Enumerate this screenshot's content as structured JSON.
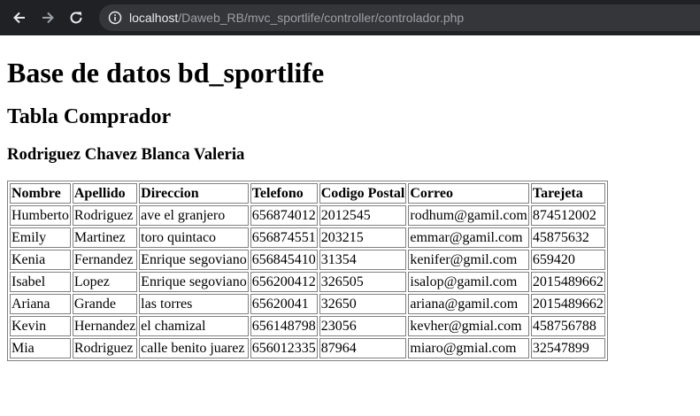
{
  "browser": {
    "url_host": "localhost",
    "url_path": "/Daweb_RB/mvc_sportlife/controller/controlador.php"
  },
  "page": {
    "title": "Base de datos bd_sportlife",
    "subtitle": "Tabla Comprador",
    "author": "Rodriguez Chavez Blanca Valeria"
  },
  "table": {
    "headers": [
      "Nombre",
      "Apellido",
      "Direccion",
      "Telefono",
      "Codigo Postal",
      "Correo",
      "Tarejeta"
    ],
    "rows": [
      [
        "Humberto",
        "Rodriguez",
        "ave el granjero",
        "656874012",
        "2012545",
        "rodhum@gamil.com",
        "874512002"
      ],
      [
        "Emily",
        "Martinez",
        "toro quintaco",
        "656874551",
        "203215",
        "emmar@gamil.com",
        "45875632"
      ],
      [
        "Kenia",
        "Fernandez",
        "Enrique segoviano",
        "656845410",
        "31354",
        "kenifer@gmil.com",
        "659420"
      ],
      [
        "Isabel",
        "Lopez",
        "Enrique segoviano",
        "656200412",
        "326505",
        "isalop@gamil.com",
        "2015489662"
      ],
      [
        "Ariana",
        "Grande",
        "las torres",
        "65620041",
        "32650",
        "ariana@gamil.com",
        "2015489662"
      ],
      [
        "Kevin",
        "Hernandez",
        "el chamizal",
        "656148798",
        "23056",
        "kevher@gmial.com",
        "458756788"
      ],
      [
        "Mia",
        "Rodriguez",
        "calle benito juarez",
        "656012335",
        "87964",
        "miaro@gmial.com",
        "32547899"
      ]
    ]
  }
}
